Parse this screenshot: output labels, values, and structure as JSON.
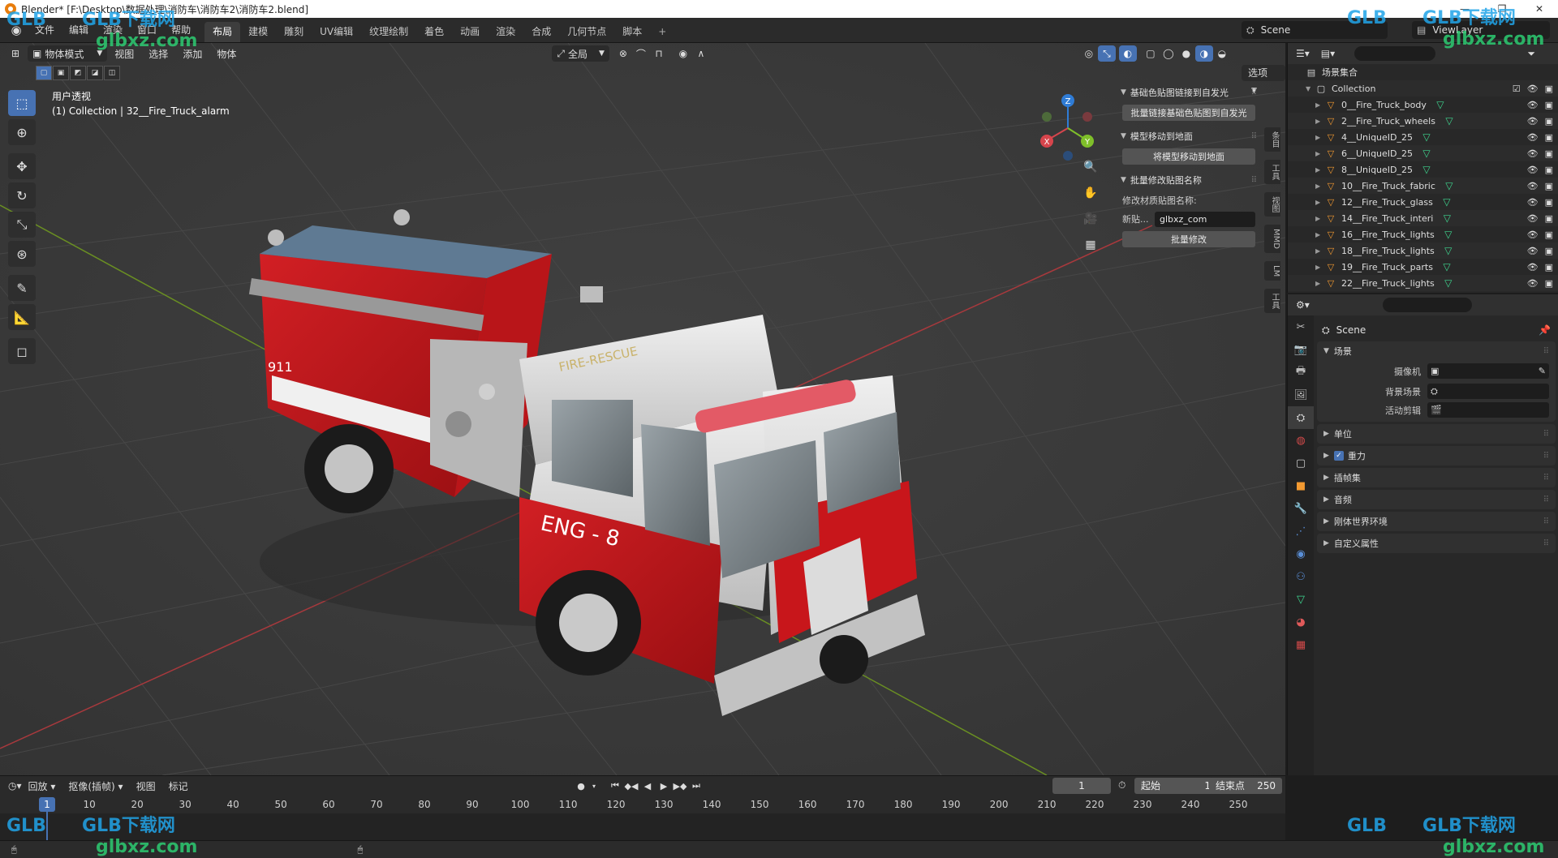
{
  "window": {
    "title": "Blender* [F:\\Desktop\\数据处理\\消防车\\消防车2\\消防车2.blend]",
    "controls": [
      "—",
      "❐",
      "✕"
    ]
  },
  "menu": {
    "items": [
      "文件",
      "编辑",
      "渲染",
      "窗口",
      "帮助"
    ],
    "workspaces": [
      "布局",
      "建模",
      "雕刻",
      "UV编辑",
      "纹理绘制",
      "着色",
      "动画",
      "渲染",
      "合成",
      "几何节点",
      "脚本"
    ],
    "active_workspace": "布局",
    "add_workspace": "+",
    "scene_name": "Scene",
    "view_layer": "ViewLayer"
  },
  "viewport": {
    "mode": "物体模式",
    "menus": [
      "视图",
      "选择",
      "添加",
      "物体"
    ],
    "orientation": "全局",
    "options": "选项",
    "view_name": "用户透视",
    "collection_info": "(1) Collection | 32__Fire_Truck_alarm",
    "gizmo_axes": [
      "X",
      "Y",
      "Z"
    ]
  },
  "npanel": {
    "sections": [
      {
        "title": "基础色贴图链接到自发光",
        "button": "批量链接基础色贴图到自发光"
      },
      {
        "title": "模型移动到地面",
        "button": "将模型移动到地面"
      },
      {
        "title": "批量修改贴图名称",
        "label": "修改材质贴图名称:",
        "field_label": "新贴...",
        "field_value": "glbxz_com",
        "button": "批量修改"
      }
    ],
    "tabs": [
      "条目",
      "工具",
      "视图",
      "MMD",
      "LM",
      "工具"
    ]
  },
  "outliner": {
    "search_placeholder": "",
    "root": "场景集合",
    "collection": "Collection",
    "items": [
      "0__Fire_Truck_body",
      "2__Fire_Truck_wheels",
      "4__UniqueID_25",
      "6__UniqueID_25",
      "8__UniqueID_25",
      "10__Fire_Truck_fabric",
      "12__Fire_Truck_glass",
      "14__Fire_Truck_interi",
      "16__Fire_Truck_lights",
      "18__Fire_Truck_lights",
      "19__Fire_Truck_parts",
      "22__Fire_Truck_lights"
    ]
  },
  "properties": {
    "context": "Scene",
    "panel_scene": "场景",
    "fields": [
      {
        "label": "摄像机",
        "value": ""
      },
      {
        "label": "背景场景",
        "value": ""
      },
      {
        "label": "活动剪辑",
        "value": ""
      }
    ],
    "panels": [
      "单位",
      "重力",
      "插帧集",
      "音频",
      "刚体世界环境",
      "自定义属性"
    ]
  },
  "timeline": {
    "menus": [
      "回放",
      "抠像(插帧)",
      "视图",
      "标记"
    ],
    "current_frame": "1",
    "start_label": "起始",
    "start": "1",
    "end_label": "结束点",
    "end": "250",
    "ruler": [
      "1",
      "10",
      "20",
      "30",
      "40",
      "50",
      "60",
      "70",
      "80",
      "90",
      "100",
      "110",
      "120",
      "130",
      "140",
      "150",
      "160",
      "170",
      "180",
      "190",
      "200",
      "210",
      "220",
      "230",
      "240",
      "250"
    ]
  },
  "watermark": {
    "brand": "GLB下载网",
    "url": "glbxz.com",
    "short": "GLB"
  },
  "colors": {
    "accent": "#4772b3",
    "truck_red": "#c8161b",
    "x_axis": "#c53a3f",
    "y_axis": "#6e9a1f"
  }
}
